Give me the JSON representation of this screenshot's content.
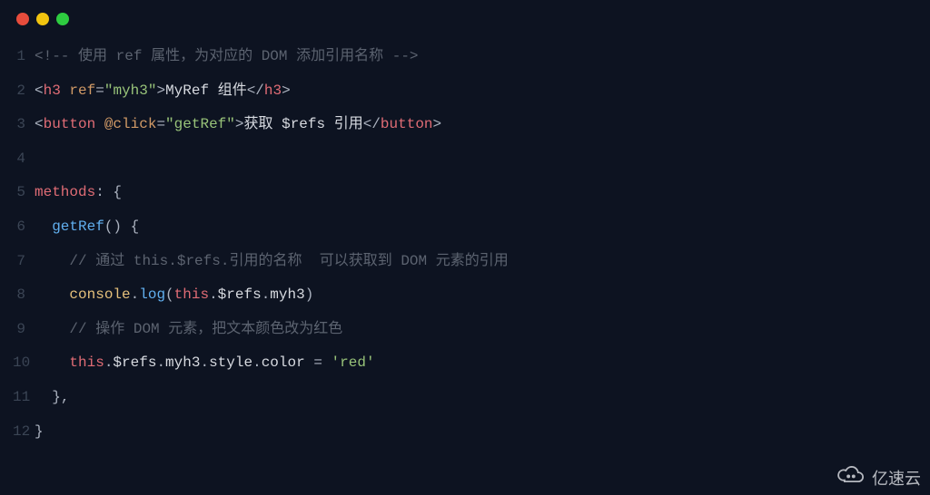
{
  "window_controls": [
    "red",
    "yellow",
    "green"
  ],
  "watermark": {
    "text": "亿速云"
  },
  "lines": {
    "l1": {
      "num": "1",
      "tokens": {
        "comment_open": "<!-- ",
        "t1": "使用",
        "sp1": " ",
        "kw1": "ref",
        "sp2": " ",
        "t2": "属性，为对应的",
        "sp3": " ",
        "kw2": "DOM",
        "sp4": " ",
        "t3": "添加引用名称",
        "comment_close": " -->"
      }
    },
    "l2": {
      "num": "2",
      "tokens": {
        "lt": "<",
        "tag": "h3",
        "sp1": " ",
        "attr": "ref",
        "eq": "=",
        "q1": "\"",
        "val": "myh3",
        "q2": "\"",
        "gt": ">",
        "text1": "MyRef ",
        "text2": "组件",
        "lt2": "</",
        "tag2": "h3",
        "gt2": ">"
      }
    },
    "l3": {
      "num": "3",
      "tokens": {
        "lt": "<",
        "tag": "button",
        "sp1": " ",
        "attr": "@click",
        "eq": "=",
        "q1": "\"",
        "val": "getRef",
        "q2": "\"",
        "gt": ">",
        "text1": "获取 ",
        "text2": "$refs",
        "text3": " 引用",
        "lt2": "</",
        "tag2": "button",
        "gt2": ">"
      }
    },
    "l4": {
      "num": "4"
    },
    "l5": {
      "num": "5",
      "tokens": {
        "methods": "methods",
        "colon": ": ",
        "brace": "{"
      }
    },
    "l6": {
      "num": "6",
      "tokens": {
        "indent": "  ",
        "fn": "getRef",
        "parens": "() ",
        "brace": "{"
      }
    },
    "l7": {
      "num": "7",
      "tokens": {
        "indent": "    ",
        "slashes": "// ",
        "t1": "通过",
        "sp1": " ",
        "c1": "this.$refs.",
        "t2": "引用的名称",
        "sp2": "  ",
        "t3": "可以获取到",
        "sp3": " ",
        "c2": "DOM",
        "sp4": " ",
        "t4": "元素的引用"
      }
    },
    "l8": {
      "num": "8",
      "tokens": {
        "indent": "    ",
        "obj1": "console",
        "dot1": ".",
        "m1": "log",
        "p1": "(",
        "this": "this",
        "dot2": ".",
        "p2": "$refs",
        "dot3": ".",
        "p3": "myh3",
        "p4": ")"
      }
    },
    "l9": {
      "num": "9",
      "tokens": {
        "indent": "    ",
        "slashes": "// ",
        "t1": "操作",
        "sp1": " ",
        "c1": "DOM",
        "sp2": " ",
        "t2": "元素，把文本颜色改为红色"
      }
    },
    "l10": {
      "num": "10",
      "tokens": {
        "indent": "    ",
        "this": "this",
        "dot1": ".",
        "p1": "$refs",
        "dot2": ".",
        "p2": "myh3",
        "dot3": ".",
        "p3": "style",
        "dot4": ".",
        "p4": "color",
        "sp": " ",
        "eq": "=",
        "sp2": " ",
        "str": "'red'"
      }
    },
    "l11": {
      "num": "11",
      "tokens": {
        "indent": "  ",
        "brace": "}",
        "comma": ","
      }
    },
    "l12": {
      "num": "12",
      "tokens": {
        "brace": "}"
      }
    }
  }
}
